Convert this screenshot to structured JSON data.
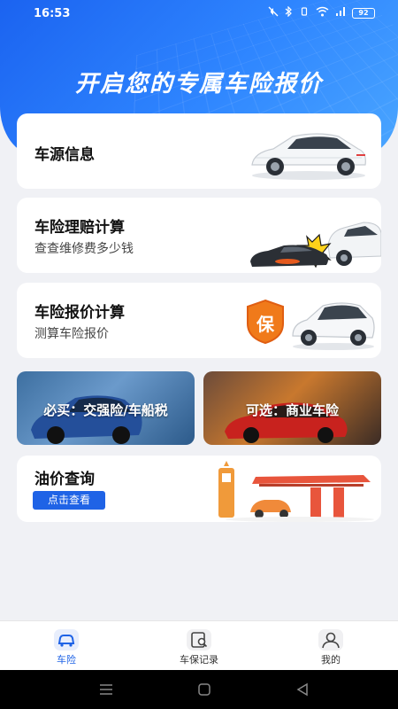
{
  "status_bar": {
    "time": "16:53",
    "battery": "92"
  },
  "hero": {
    "title": "开启您的专属车险报价"
  },
  "cards": {
    "car_source": {
      "title": "车源信息"
    },
    "claim_calc": {
      "title": "车险理赔计算",
      "subtitle": "查查维修费多少钱"
    },
    "quote_calc": {
      "title": "车险报价计算",
      "subtitle": "测算车险报价",
      "badge": "保"
    },
    "oil_price": {
      "title": "油价查询",
      "button": "点击查看"
    }
  },
  "banners": {
    "required": "必买：交强险/车船税",
    "optional": "可选：商业车险"
  },
  "tabbar": {
    "tabs": [
      {
        "label": "车险",
        "active": true
      },
      {
        "label": "车保记录",
        "active": false
      },
      {
        "label": "我的",
        "active": false
      }
    ]
  },
  "colors": {
    "primary": "#1f63e6",
    "hero": "#2f86ff",
    "badge": "#f07a1a"
  }
}
